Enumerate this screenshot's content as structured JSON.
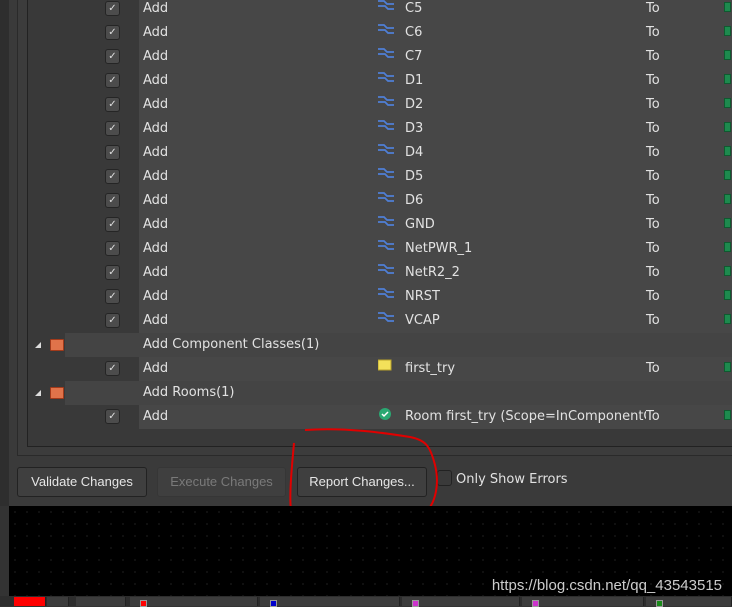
{
  "rows": [
    {
      "action": "Add",
      "name": "C5",
      "to": "To"
    },
    {
      "action": "Add",
      "name": "C6",
      "to": "To"
    },
    {
      "action": "Add",
      "name": "C7",
      "to": "To"
    },
    {
      "action": "Add",
      "name": "D1",
      "to": "To"
    },
    {
      "action": "Add",
      "name": "D2",
      "to": "To"
    },
    {
      "action": "Add",
      "name": "D3",
      "to": "To"
    },
    {
      "action": "Add",
      "name": "D4",
      "to": "To"
    },
    {
      "action": "Add",
      "name": "D5",
      "to": "To"
    },
    {
      "action": "Add",
      "name": "D6",
      "to": "To"
    },
    {
      "action": "Add",
      "name": "GND",
      "to": "To"
    },
    {
      "action": "Add",
      "name": "NetPWR_1",
      "to": "To"
    },
    {
      "action": "Add",
      "name": "NetR2_2",
      "to": "To"
    },
    {
      "action": "Add",
      "name": "NRST",
      "to": "To"
    },
    {
      "action": "Add",
      "name": "VCAP",
      "to": "To"
    }
  ],
  "groups": [
    {
      "label": "Add Component Classes(1)",
      "child": {
        "action": "Add",
        "name": "first_try",
        "to": "To",
        "icon": "folder-icon"
      }
    },
    {
      "label": "Add Rooms(1)",
      "child": {
        "action": "Add",
        "name": "Room first_try (Scope=InComponentCl",
        "to": "To",
        "icon": "check-circle-icon"
      }
    }
  ],
  "buttons": {
    "validate": "Validate Changes",
    "execute": "Execute Changes",
    "report": "Report Changes...",
    "only_errors": "Only Show Errors"
  },
  "watermark": "https://blog.csdn.net/qq_43543515",
  "colors": {
    "net_icon": "#4f7fd6",
    "annotation": "#e00000",
    "tab_squares": [
      "#ff0000",
      "#0000cc",
      "#cc33cc",
      "#cc33cc",
      "#1a8a1a"
    ]
  }
}
